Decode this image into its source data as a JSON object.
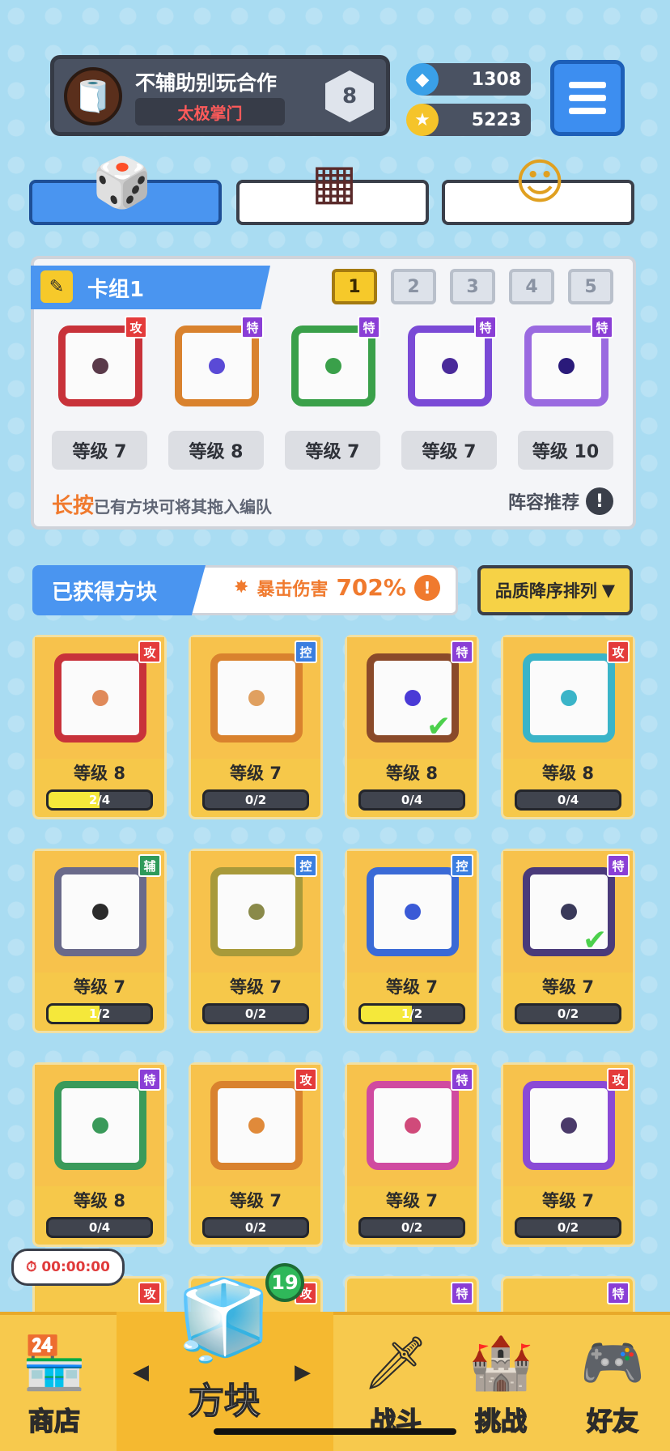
{
  "profile": {
    "name": "不辅助别玩合作",
    "clan": "太极掌门",
    "rank": "8",
    "avatar_icon": "scroll-icon"
  },
  "currency": {
    "gems": "1308",
    "coins": "5223"
  },
  "top_tabs": [
    {
      "name": "dice",
      "icon": "🎲"
    },
    {
      "name": "board",
      "icon": "▦"
    },
    {
      "name": "emote",
      "icon": "☺"
    }
  ],
  "deck": {
    "title": "卡组1",
    "numbers": [
      "1",
      "2",
      "3",
      "4",
      "5"
    ],
    "cards": [
      {
        "badge": "攻",
        "badge_color": "#e43b3b",
        "frame_color": "#c8323a",
        "dot": "#5a3a4a",
        "level": "等级 7"
      },
      {
        "badge": "特",
        "badge_color": "#8a3ed6",
        "frame_color": "#d9822e",
        "dot": "#5a4ad6",
        "level": "等级 8"
      },
      {
        "badge": "特",
        "badge_color": "#8a3ed6",
        "frame_color": "#3aa04a",
        "dot": "#3aa04a",
        "level": "等级 7"
      },
      {
        "badge": "特",
        "badge_color": "#8a3ed6",
        "frame_color": "#7a4ad6",
        "dot": "#4a2a9a",
        "level": "等级 7"
      },
      {
        "badge": "特",
        "badge_color": "#8a3ed6",
        "frame_color": "#9a6ae0",
        "dot": "#2a1a7a",
        "level": "等级 10"
      }
    ],
    "hint_strong": "长按",
    "hint_rest": "已有方块可将其拖入编队",
    "recommend": "阵容推荐",
    "recommend_icon": "!"
  },
  "owned": {
    "title": "已获得方块",
    "crit_label": "暴击伤害",
    "crit_value": "702%",
    "crit_icon": "!",
    "sort_label": "品质降序排列",
    "sort_arrow": "▼",
    "cards": [
      {
        "badge": "攻",
        "badge_color": "#e43b3b",
        "frame_color": "#c8323a",
        "dot": "#e08a5a",
        "level": "等级 8",
        "progress": "2/4",
        "fill": 0.5,
        "check": false
      },
      {
        "badge": "控",
        "badge_color": "#3a7ee0",
        "frame_color": "#d9822e",
        "dot": "#e0a060",
        "level": "等级 7",
        "progress": "0/2",
        "fill": 0,
        "check": false
      },
      {
        "badge": "特",
        "badge_color": "#8a3ed6",
        "frame_color": "#8a4a2a",
        "dot": "#4a3ad6",
        "level": "等级 8",
        "progress": "0/4",
        "fill": 0,
        "check": true
      },
      {
        "badge": "攻",
        "badge_color": "#e43b3b",
        "frame_color": "#3ab4c8",
        "dot": "#3ab4c8",
        "level": "等级 8",
        "progress": "0/4",
        "fill": 0,
        "check": false
      },
      {
        "badge": "辅",
        "badge_color": "#2e9a5a",
        "frame_color": "#6a6a8a",
        "dot": "#2b2b2b",
        "level": "等级 7",
        "progress": "1/2",
        "fill": 0.5,
        "check": false
      },
      {
        "badge": "控",
        "badge_color": "#3a7ee0",
        "frame_color": "#a89a3a",
        "dot": "#8a8a4a",
        "level": "等级 7",
        "progress": "0/2",
        "fill": 0,
        "check": false
      },
      {
        "badge": "控",
        "badge_color": "#3a7ee0",
        "frame_color": "#3a6ad6",
        "dot": "#3a5ad6",
        "level": "等级 7",
        "progress": "1/2",
        "fill": 0.5,
        "check": false
      },
      {
        "badge": "特",
        "badge_color": "#8a3ed6",
        "frame_color": "#4a3a7a",
        "dot": "#3a3a5a",
        "level": "等级 7",
        "progress": "0/2",
        "fill": 0,
        "check": true
      },
      {
        "badge": "特",
        "badge_color": "#8a3ed6",
        "frame_color": "#3a9a5a",
        "dot": "#3a9a5a",
        "level": "等级 8",
        "progress": "0/4",
        "fill": 0,
        "check": false
      },
      {
        "badge": "攻",
        "badge_color": "#e43b3b",
        "frame_color": "#d9822e",
        "dot": "#e08a3a",
        "level": "等级 7",
        "progress": "0/2",
        "fill": 0,
        "check": false
      },
      {
        "badge": "特",
        "badge_color": "#8a3ed6",
        "frame_color": "#d04aa0",
        "dot": "#d04a7a",
        "level": "等级 7",
        "progress": "0/2",
        "fill": 0,
        "check": false
      },
      {
        "badge": "攻",
        "badge_color": "#e43b3b",
        "frame_color": "#8a4ad6",
        "dot": "#4a3a6a",
        "level": "等级 7",
        "progress": "0/2",
        "fill": 0,
        "check": false
      }
    ],
    "partial_badges": [
      "攻",
      "攻",
      "特",
      "特"
    ]
  },
  "timer": "00:00:00",
  "nav": {
    "shop": "商店",
    "blocks": "方块",
    "battle": "战斗",
    "challenge": "挑战",
    "friends": "好友",
    "blocks_count": "19",
    "left_arrow": "◀",
    "right_arrow": "▶",
    "icons": {
      "shop": "🏪",
      "blocks": "🧊",
      "battle": "🗡",
      "challenge": "🏰",
      "friends": "🎮"
    }
  },
  "colors": {
    "accent": "#4a95f0",
    "gold": "#f7c94d",
    "attack": "#e43b3b",
    "special": "#8a3ed6",
    "control": "#3a7ee0",
    "support": "#2e9a5a"
  }
}
